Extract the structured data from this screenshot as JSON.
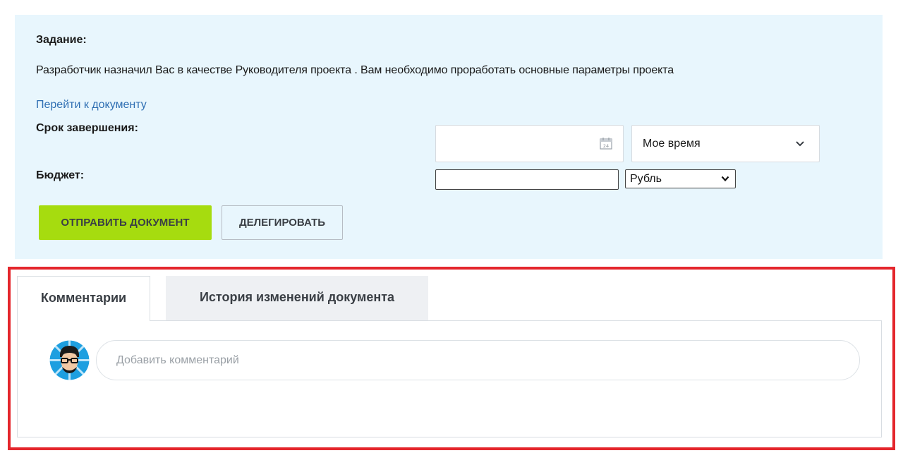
{
  "task": {
    "heading": "Задание:",
    "text": "Разработчик назначил Вас в качестве Руководителя проекта . Вам необходимо проработать основные параметры проекта",
    "doc_link": "Перейти к документу",
    "deadline_label": "Срок завершения:",
    "budget_label": "Бюджет:",
    "date_value": "",
    "time_select_value": "Мое время",
    "budget_value": "",
    "currency_value": "Рубль",
    "calendar_icon_day": "24",
    "send_button": "ОТПРАВИТЬ ДОКУМЕНТ",
    "delegate_button": "ДЕЛЕГИРОВАТЬ"
  },
  "tabs": [
    {
      "label": "Комментарии",
      "active": true
    },
    {
      "label": "История изменений документа",
      "active": false
    }
  ],
  "comments": {
    "placeholder": "Добавить комментарий"
  },
  "icons": {
    "calendar": "calendar-icon",
    "time_chevron": "chevron-down-icon",
    "currency_chevron": "chevron-down-icon",
    "avatar": "avatar"
  },
  "colors": {
    "panel_bg": "#e8f6fd",
    "send_button_bg": "#a6dc0f",
    "link": "#2f6fb3",
    "highlight": "#e4262c"
  }
}
